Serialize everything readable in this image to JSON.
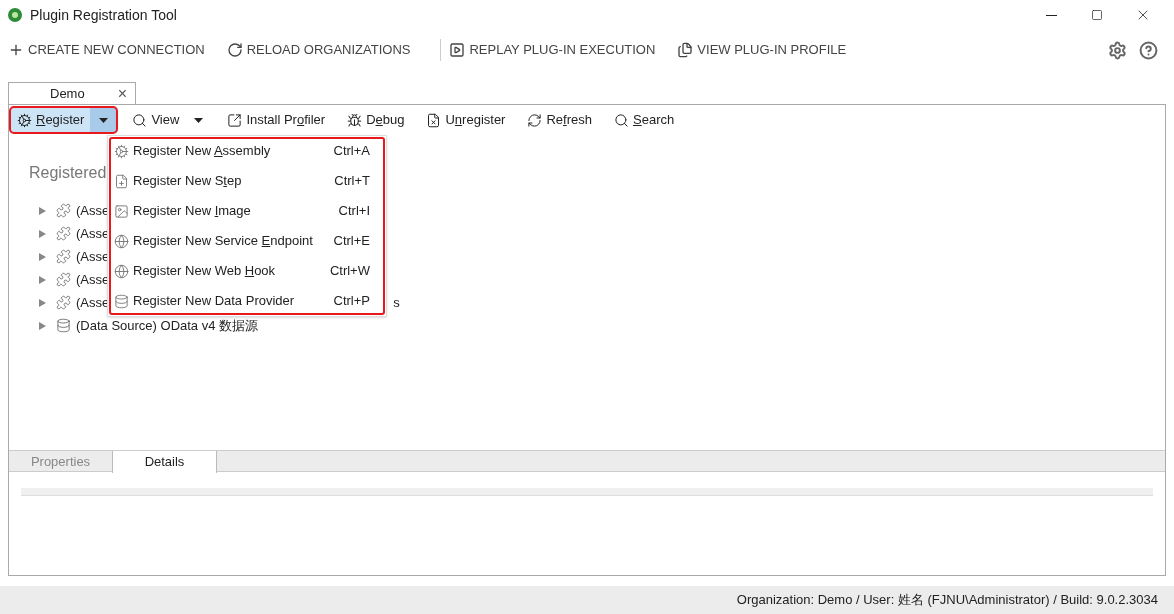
{
  "window": {
    "title": "Plugin Registration Tool"
  },
  "commands": [
    {
      "kind": "plus",
      "label": "CREATE NEW CONNECTION"
    },
    {
      "kind": "reload",
      "label": "RELOAD ORGANIZATIONS"
    },
    {
      "kind": "separator"
    },
    {
      "kind": "replay",
      "label": "REPLAY PLUG-IN EXECUTION"
    },
    {
      "kind": "profile",
      "label": "VIEW PLUG-IN PROFILE"
    }
  ],
  "connection_tab": {
    "label": "Demo",
    "close": "×"
  },
  "toolbar": [
    {
      "kind": "register",
      "label": {
        "key": "R",
        "after": "egister"
      },
      "dropdown": true,
      "selected": true,
      "highlighted": true
    },
    {
      "kind": "view",
      "label": {
        "before": "View"
      },
      "dropdown": true,
      "selected": false,
      "highlighted": false
    },
    {
      "kind": "install",
      "label": {
        "before": "Install Pr",
        "key": "o",
        "after": "filer"
      },
      "dropdown": false,
      "selected": false,
      "highlighted": false
    },
    {
      "kind": "debug",
      "label": {
        "before": "D",
        "key": "e",
        "after": "bug"
      },
      "dropdown": false,
      "selected": false,
      "highlighted": false
    },
    {
      "kind": "unregister",
      "label": {
        "before": "U",
        "key": "n",
        "after": "register"
      },
      "dropdown": false,
      "selected": false,
      "highlighted": false
    },
    {
      "kind": "refresh",
      "label": {
        "before": "Re",
        "key": "f",
        "after": "resh"
      },
      "dropdown": false,
      "selected": false,
      "highlighted": false
    },
    {
      "kind": "search",
      "label": {
        "key": "S",
        "after": "earch"
      },
      "dropdown": false,
      "selected": false,
      "highlighted": false
    }
  ],
  "register_menu": {
    "highlighted": true,
    "items": [
      {
        "kind": "assembly",
        "label": {
          "before": "Register New ",
          "key": "A",
          "after": "ssembly"
        },
        "shortcut": "Ctrl+A"
      },
      {
        "kind": "step",
        "label": {
          "before": "Register New S",
          "key": "t",
          "after": "ep"
        },
        "shortcut": "Ctrl+T"
      },
      {
        "kind": "image",
        "label": {
          "before": "Register New ",
          "key": "I",
          "after": "mage"
        },
        "shortcut": "Ctrl+I"
      },
      {
        "kind": "endpoint",
        "label": {
          "before": "Register New Service ",
          "key": "E",
          "after": "ndpoint"
        },
        "shortcut": "Ctrl+E"
      },
      {
        "kind": "webhook",
        "label": {
          "before": "Register New Web ",
          "key": "H",
          "after": "ook"
        },
        "shortcut": "Ctrl+W"
      },
      {
        "kind": "dataprovider",
        "label": {
          "before": "Register New Data Provider"
        },
        "shortcut": "Ctrl+P"
      }
    ]
  },
  "tree": {
    "heading": "Registered",
    "items": [
      {
        "kind": "assembly",
        "label": "(Asse",
        "expanded": false
      },
      {
        "kind": "assembly",
        "label": "(Asse",
        "expanded": false
      },
      {
        "kind": "assembly",
        "label": "(Asse",
        "expanded": false
      },
      {
        "kind": "assembly",
        "label": "(Asse",
        "expanded": false
      },
      {
        "kind": "assembly",
        "label": "(Asse",
        "tail": "s",
        "expanded": false
      },
      {
        "kind": "datasource",
        "label": "(Data Source) OData v4 数据源",
        "expanded": false
      }
    ]
  },
  "bottom_tabs": [
    {
      "label": "Properties",
      "selected": false
    },
    {
      "label": "Details",
      "selected": true
    }
  ],
  "status_bar": "Organization: Demo / User: 姓名 (FJNU\\Administrator) / Build: 9.0.2.3034"
}
